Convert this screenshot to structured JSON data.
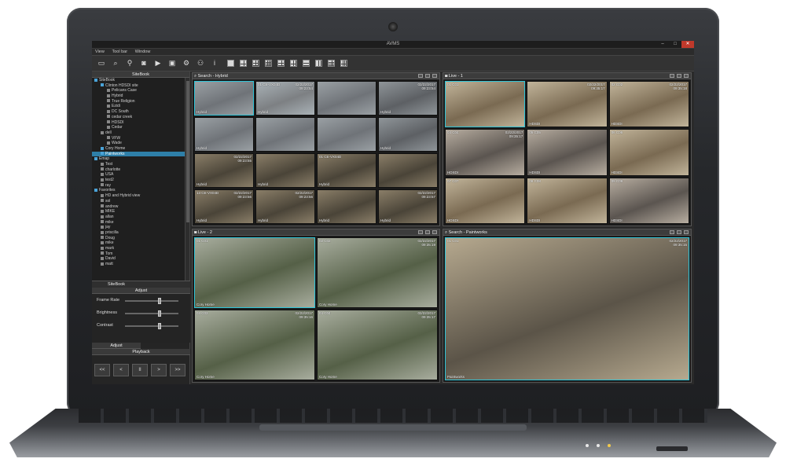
{
  "window": {
    "title": "AVMS",
    "minimize": "–",
    "maximize": "□",
    "close": "✕"
  },
  "menu": [
    "View",
    "Tool bar",
    "Window"
  ],
  "toolbar_icons": [
    "monitor-icon",
    "search-icon",
    "map-pin-icon",
    "camera-icon",
    "playback-icon",
    "video-icon",
    "gear-icon",
    "users-icon",
    "info-icon"
  ],
  "sitebook": {
    "title": "SiteBook",
    "items": [
      {
        "label": "SiteBook",
        "level": 0,
        "color": "#4aa3d8"
      },
      {
        "label": "Clinton HDSDI site",
        "level": 1,
        "color": "#4aa3d8"
      },
      {
        "label": "Pelicans Case",
        "level": 2,
        "color": "#888888"
      },
      {
        "label": "Hybrid",
        "level": 2,
        "color": "#888888"
      },
      {
        "label": "True Religion",
        "level": 2,
        "color": "#888888"
      },
      {
        "label": "Ezidi",
        "level": 2,
        "color": "#888888"
      },
      {
        "label": "DC South",
        "level": 2,
        "color": "#888888"
      },
      {
        "label": "cedar creek",
        "level": 2,
        "color": "#888888"
      },
      {
        "label": "HDSDI",
        "level": 2,
        "color": "#888888"
      },
      {
        "label": "Cedar",
        "level": 2,
        "color": "#888888"
      },
      {
        "label": "dell",
        "level": 1,
        "color": "#888888"
      },
      {
        "label": "VFW",
        "level": 2,
        "color": "#888888"
      },
      {
        "label": "Wade",
        "level": 2,
        "color": "#888888"
      },
      {
        "label": "Cory Home",
        "level": 1,
        "color": "#4aa3d8"
      },
      {
        "label": "Paintworks",
        "level": 1,
        "color": "#4aa3d8",
        "selected": true
      },
      {
        "label": "Emap",
        "level": 0,
        "color": "#4aa3d8"
      },
      {
        "label": "Test",
        "level": 1,
        "color": "#888888"
      },
      {
        "label": "charlotte",
        "level": 1,
        "color": "#888888"
      },
      {
        "label": "USA",
        "level": 1,
        "color": "#888888"
      },
      {
        "label": "test2",
        "level": 1,
        "color": "#888888"
      },
      {
        "label": "ray",
        "level": 1,
        "color": "#888888"
      },
      {
        "label": "Favorites",
        "level": 0,
        "color": "#4aa3d8"
      },
      {
        "label": "HD and Hybrid view",
        "level": 1,
        "color": "#888888"
      },
      {
        "label": "sol",
        "level": 1,
        "color": "#888888"
      },
      {
        "label": "andrew",
        "level": 1,
        "color": "#888888"
      },
      {
        "label": "MIKE",
        "level": 1,
        "color": "#888888"
      },
      {
        "label": "allan",
        "level": 1,
        "color": "#888888"
      },
      {
        "label": "mike",
        "level": 1,
        "color": "#888888"
      },
      {
        "label": "jay",
        "level": 1,
        "color": "#888888"
      },
      {
        "label": "priscilla",
        "level": 1,
        "color": "#888888"
      },
      {
        "label": "Doug",
        "level": 1,
        "color": "#888888"
      },
      {
        "label": "mike",
        "level": 1,
        "color": "#888888"
      },
      {
        "label": "mark",
        "level": 1,
        "color": "#888888"
      },
      {
        "label": "Tom",
        "level": 1,
        "color": "#888888"
      },
      {
        "label": "David",
        "level": 1,
        "color": "#888888"
      },
      {
        "label": "matt",
        "level": 1,
        "color": "#888888"
      }
    ],
    "tabs": [
      "SiteBook",
      ""
    ]
  },
  "adjust": {
    "title": "Adjust",
    "rows": [
      {
        "label": "Frame Rate",
        "level": 0.65
      },
      {
        "label": "Brightness",
        "level": 0.65
      },
      {
        "label": "Contrast",
        "level": 0.65
      }
    ],
    "tab": "Adjust"
  },
  "playback": {
    "title": "Playback",
    "buttons": [
      {
        "name": "rewind-fast-button",
        "label": "<<"
      },
      {
        "name": "step-back-button",
        "label": "<"
      },
      {
        "name": "pause-button",
        "label": "II"
      },
      {
        "name": "step-forward-button",
        "label": ">"
      },
      {
        "name": "fast-forward-button",
        "label": ">>"
      }
    ]
  },
  "panes": [
    {
      "id": "search-hybrid",
      "title": "Search - Hybrid",
      "icon": "search-icon",
      "cols": 4,
      "cams": [
        {
          "label": "",
          "ts": "",
          "bottom": "Hybrid",
          "scene": "parking",
          "sel": true
        },
        {
          "label": "01 CE-VX04D",
          "ts": "02/22/2017\n09:23:54",
          "bottom": "Hybrid",
          "scene": "street"
        },
        {
          "label": "",
          "ts": "",
          "bottom": "",
          "scene": "parking"
        },
        {
          "label": "",
          "ts": "02/22/2017\n09:23:54",
          "bottom": "Hybrid",
          "scene": "cars"
        },
        {
          "label": "",
          "ts": "",
          "bottom": "Hybrid",
          "scene": "parking"
        },
        {
          "label": "",
          "ts": "",
          "bottom": "",
          "scene": "parking"
        },
        {
          "label": "",
          "ts": "",
          "bottom": "",
          "scene": "parking"
        },
        {
          "label": "",
          "ts": "",
          "bottom": "Hybrid",
          "scene": "cars"
        },
        {
          "label": "",
          "ts": "02/22/2017\n09:23:55",
          "bottom": "Hybrid",
          "scene": "warehouse"
        },
        {
          "label": "",
          "ts": "",
          "bottom": "Hybrid",
          "scene": "warehouse"
        },
        {
          "label": "01 CE-VX04D",
          "ts": "",
          "bottom": "Hybrid",
          "scene": "warehouse"
        },
        {
          "label": "",
          "ts": "",
          "bottom": "",
          "scene": "warehouse"
        },
        {
          "label": "13 CE-VX04D",
          "ts": "02/22/2017\n09:23:56",
          "bottom": "Hybrid",
          "scene": "warehouse"
        },
        {
          "label": "",
          "ts": "02/22/2017\n09:23:56",
          "bottom": "Hybrid",
          "scene": "warehouse"
        },
        {
          "label": "",
          "ts": "",
          "bottom": "Hybrid",
          "scene": "warehouse"
        },
        {
          "label": "",
          "ts": "02/22/2017\n09:23:57",
          "bottom": "Hybrid",
          "scene": "warehouse"
        }
      ]
    },
    {
      "id": "live-1",
      "title": "Live - 1",
      "icon": "camera-icon",
      "cols": 3,
      "cams": [
        {
          "label": "01 C01",
          "ts": "",
          "bottom": "",
          "scene": "office",
          "sel": true
        },
        {
          "label": "",
          "ts": "02/22/2017\n09:35:17",
          "bottom": "HDSDI",
          "scene": "office"
        },
        {
          "label": "02 C02",
          "ts": "02/22/2017\n09:35:18",
          "bottom": "HDSDI",
          "scene": "office"
        },
        {
          "label": "04 C04",
          "ts": "02/22/2017\n09:35:17",
          "bottom": "HDSDI",
          "scene": "hallway"
        },
        {
          "label": "05 C05",
          "ts": "",
          "bottom": "HDSDI",
          "scene": "hallway"
        },
        {
          "label": "06 C06",
          "ts": "",
          "bottom": "HDSDI",
          "scene": "office"
        },
        {
          "label": "07 C07",
          "ts": "",
          "bottom": "HDSDI",
          "scene": "office"
        },
        {
          "label": "08 C08",
          "ts": "",
          "bottom": "HDSDI",
          "scene": "office"
        },
        {
          "label": "09 C09",
          "ts": "",
          "bottom": "HDSDI",
          "scene": "hallway"
        }
      ]
    },
    {
      "id": "live-2",
      "title": "Live - 2",
      "icon": "camera-icon",
      "cols": 2,
      "cams": [
        {
          "label": "01 C01",
          "ts": "",
          "bottom": "Cory Home",
          "scene": "yard",
          "sel": true
        },
        {
          "label": "02 C02",
          "ts": "02/22/2017\n09:35:19",
          "bottom": "Cory Home",
          "scene": "yard"
        },
        {
          "label": "03 C03",
          "ts": "02/22/2017\n09:35:16",
          "bottom": "Cory Home",
          "scene": "yard"
        },
        {
          "label": "04 C04",
          "ts": "02/22/2017\n09:35:17",
          "bottom": "Cory Home",
          "scene": "yard"
        }
      ]
    },
    {
      "id": "search-paintworks",
      "title": "Search - Paintworks",
      "icon": "search-icon",
      "cols": 1,
      "cams": [
        {
          "label": "01 C01",
          "ts": "02/22/2017\n09:35:15",
          "bottom": "Paintworks",
          "scene": "shop",
          "sel": true
        }
      ]
    }
  ],
  "scene_colors": {
    "parking": [
      "#6f7378",
      "#9aa0a4"
    ],
    "street": [
      "#7d8083",
      "#a9b2b7"
    ],
    "cars": [
      "#5d6064",
      "#8f9599"
    ],
    "warehouse": [
      "#4a4438",
      "#8a7e68"
    ],
    "office": [
      "#7a6a52",
      "#c1b49a"
    ],
    "hallway": [
      "#5b5550",
      "#b7ada0"
    ],
    "yard": [
      "#556047",
      "#a8ad9e"
    ],
    "shop": [
      "#5b5448",
      "#b6a98f"
    ]
  }
}
